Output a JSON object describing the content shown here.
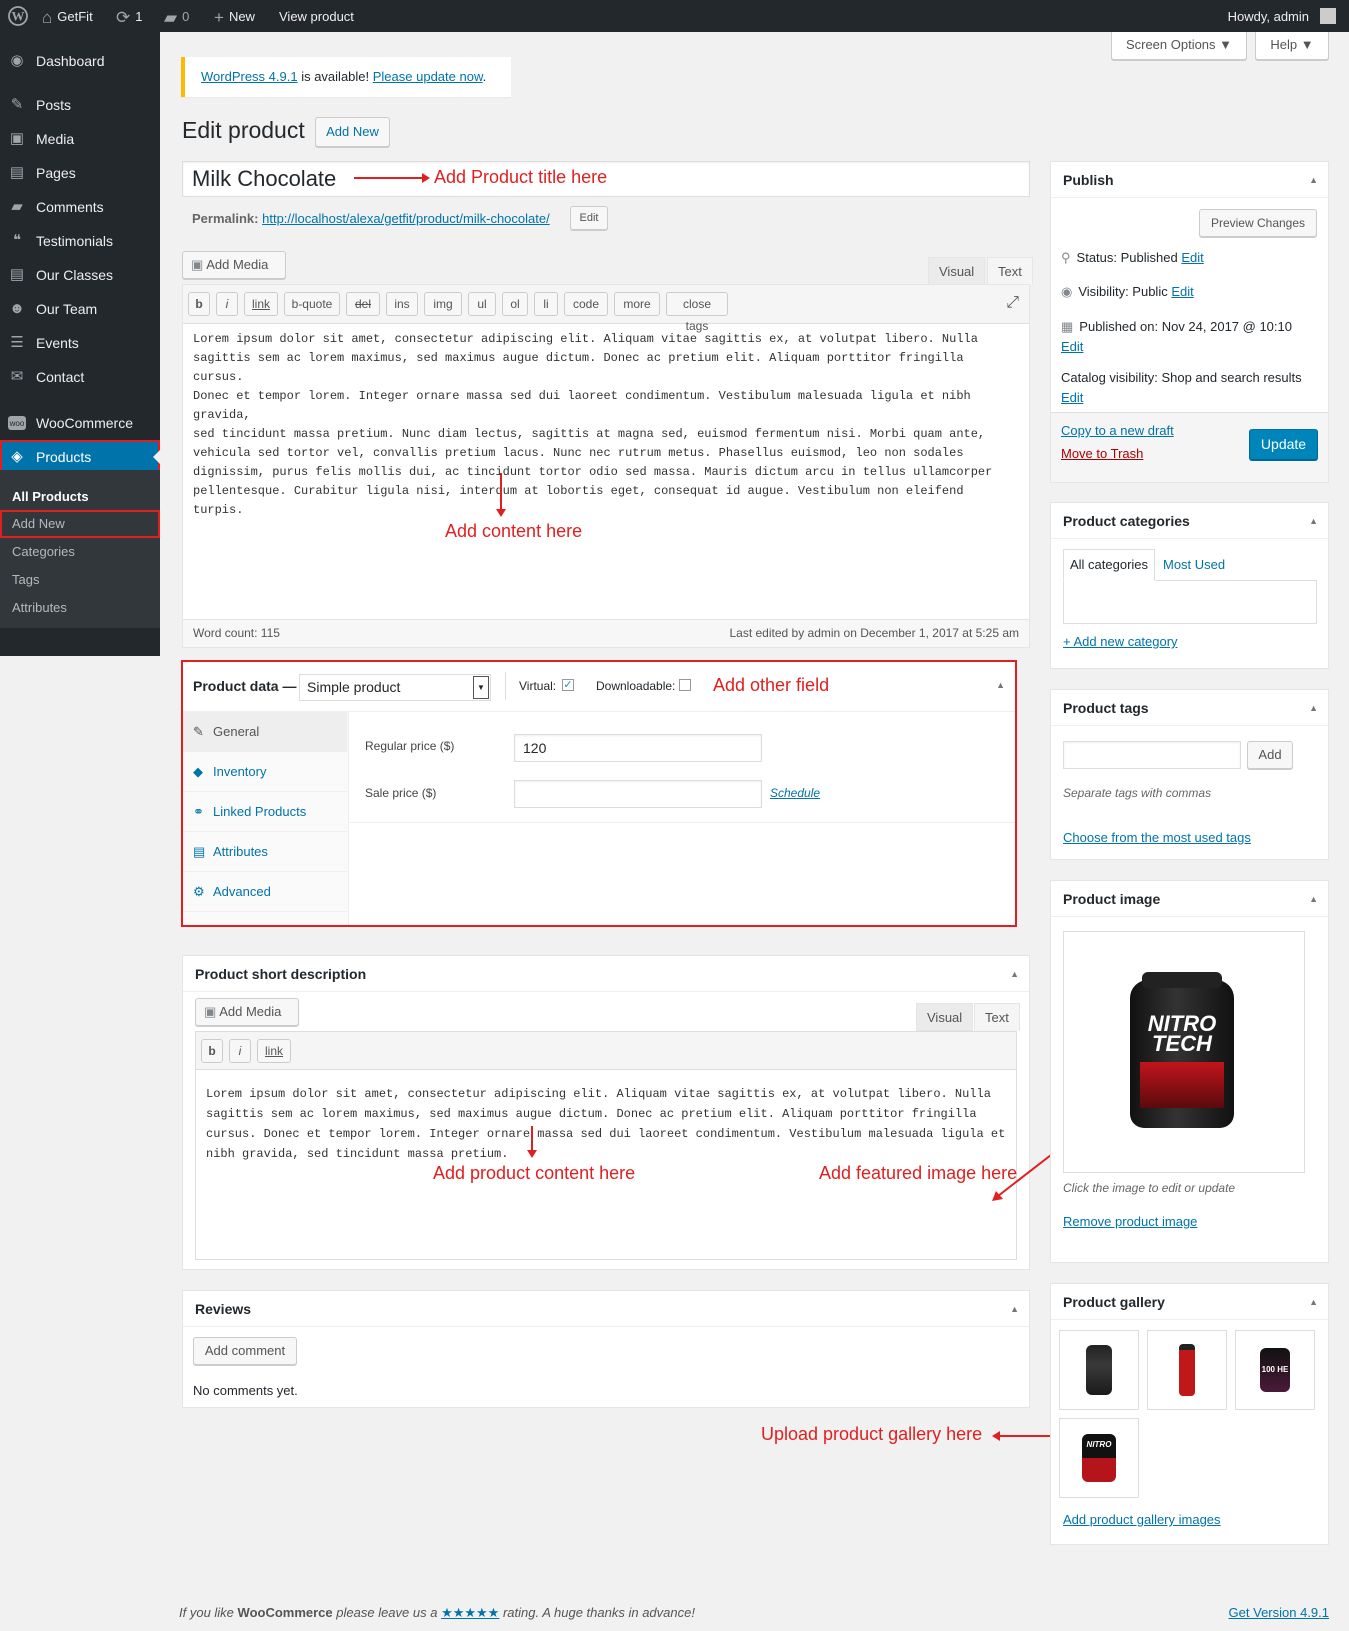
{
  "adminbar": {
    "site_name": "GetFit",
    "updates_count": "1",
    "comments_count": "0",
    "new_label": "New",
    "view_label": "View product",
    "howdy": "Howdy, admin"
  },
  "menu": {
    "items": [
      {
        "label": "Dashboard"
      },
      {
        "label": "Posts"
      },
      {
        "label": "Media"
      },
      {
        "label": "Pages"
      },
      {
        "label": "Comments"
      },
      {
        "label": "Testimonials"
      },
      {
        "label": "Our Classes"
      },
      {
        "label": "Our Team"
      },
      {
        "label": "Events"
      },
      {
        "label": "Contact"
      },
      {
        "label": "WooCommerce"
      },
      {
        "label": "Products"
      }
    ],
    "submenu": [
      "All Products",
      "Add New",
      "Categories",
      "Tags",
      "Attributes"
    ]
  },
  "screen": {
    "options_label": "Screen Options",
    "help_label": "Help"
  },
  "notice": {
    "link_version": "WordPress 4.9.1",
    "middle": " is available! ",
    "link_update": "Please update now",
    "end": "."
  },
  "page": {
    "title": "Edit product",
    "add_new_label": "Add New"
  },
  "product": {
    "title_value": "Milk Chocolate",
    "permalink_label": "Permalink:",
    "permalink_url": "http://localhost/alexa/getfit/product/milk-chocolate/",
    "permalink_edit": "Edit"
  },
  "editor": {
    "add_media": "Add Media",
    "tab_visual": "Visual",
    "tab_text": "Text",
    "quicktags": [
      "b",
      "i",
      "link",
      "b-quote",
      "del",
      "ins",
      "img",
      "ul",
      "ol",
      "li",
      "code",
      "more",
      "close tags"
    ],
    "content_lines": [
      "Lorem ipsum dolor sit amet, consectetur adipiscing elit. Aliquam vitae sagittis ex, at volutpat libero. Nulla",
      "sagittis sem ac lorem maximus, sed maximus augue dictum. Donec ac pretium elit. Aliquam porttitor fringilla cursus.",
      "Donec et tempor lorem. Integer ornare massa sed dui laoreet condimentum. Vestibulum malesuada ligula et nibh gravida,",
      "sed tincidunt massa pretium. Nunc diam lectus, sagittis at magna sed, euismod fermentum nisi. Morbi quam ante,",
      "vehicula sed tortor vel, convallis pretium lacus. Nunc nec rutrum metus. Phasellus euismod, leo non sodales",
      "dignissim, purus felis mollis dui, ac tincidunt tortor odio sed massa. Mauris dictum arcu in tellus ullamcorper",
      "pellentesque. Curabitur ligula nisi, interdum at lobortis eget, consequat id augue. Vestibulum non eleifend turpis."
    ],
    "word_count": "Word count: 115",
    "last_edited": "Last edited by admin on December 1, 2017 at 5:25 am"
  },
  "annotations": {
    "title": "Add Product title here",
    "content": "Add content here",
    "other": "Add other field",
    "short": "Add product content here",
    "featured": "Add featured image here",
    "gallery": "Upload product gallery here"
  },
  "product_data": {
    "label": "Product data —",
    "type_value": "Simple product",
    "virtual_label": "Virtual:",
    "virtual_checked": true,
    "downloadable_label": "Downloadable:",
    "downloadable_checked": false,
    "tabs": [
      "General",
      "Inventory",
      "Linked Products",
      "Attributes",
      "Advanced"
    ],
    "regular_price_label": "Regular price ($)",
    "regular_price_value": "120",
    "sale_price_label": "Sale price ($)",
    "sale_price_value": "",
    "schedule_label": "Schedule"
  },
  "short_desc": {
    "title": "Product short description",
    "add_media": "Add Media",
    "tab_visual": "Visual",
    "tab_text": "Text",
    "quicktags": [
      "b",
      "i",
      "link"
    ],
    "content_lines": [
      "Lorem ipsum dolor sit amet, consectetur adipiscing elit. Aliquam vitae sagittis ex, at volutpat libero. Nulla",
      "sagittis sem ac lorem maximus, sed maximus augue dictum. Donec ac pretium elit. Aliquam porttitor fringilla",
      "cursus. Donec et tempor lorem. Integer ornare massa sed dui laoreet condimentum. Vestibulum malesuada ligula et",
      "nibh gravida, sed tincidunt massa pretium."
    ]
  },
  "reviews": {
    "title": "Reviews",
    "add_comment": "Add comment",
    "empty": "No comments yet."
  },
  "publish": {
    "title": "Publish",
    "preview": "Preview Changes",
    "status_label": "Status: ",
    "status_value": "Published",
    "visibility_label": "Visibility: ",
    "visibility_value": "Public",
    "published_label": "Published on: ",
    "published_value": "Nov 24, 2017 @ 10:10",
    "catalog_label": "Catalog visibility: ",
    "catalog_value": "Shop and search results",
    "edit": "Edit",
    "copy_draft": "Copy to a new draft",
    "trash": "Move to Trash",
    "update": "Update"
  },
  "categories": {
    "title": "Product categories",
    "tab_all": "All categories",
    "tab_used": "Most Used",
    "add_new": "+ Add new category"
  },
  "tags": {
    "title": "Product tags",
    "input_value": "",
    "add": "Add",
    "hint": "Separate tags with commas",
    "choose": "Choose from the most used tags"
  },
  "image": {
    "title": "Product image",
    "brand_line1": "NITRO",
    "brand_line2": "TECH",
    "hint": "Click the image to edit or update",
    "remove": "Remove product image"
  },
  "gallery": {
    "title": "Product gallery",
    "add": "Add product gallery images",
    "thumb_label_3": "100 HE",
    "thumb_label_4": "NITRO"
  },
  "footer": {
    "left_a": "If you like ",
    "left_b": "WooCommerce",
    "left_c": " please leave us a ",
    "stars": "★★★★★",
    "left_d": " rating. A huge thanks in advance!",
    "version": "Get Version 4.9.1"
  },
  "colors": {
    "accent": "#0073aa",
    "annotation": "#e02020",
    "admin_bar": "#23282d"
  }
}
